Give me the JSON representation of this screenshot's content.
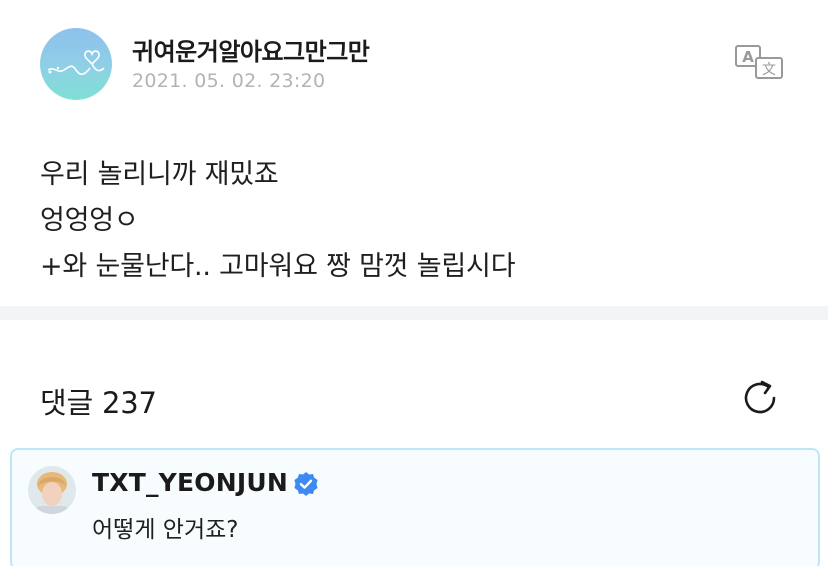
{
  "post": {
    "author": "귀여운거알아요그만그만",
    "date": "2021. 05. 02. 23:20",
    "translate_icon": "translate-icon",
    "lines": [
      "우리 놀리니까 재밌죠",
      "엉엉엉ㅇ",
      "+와 눈물난다.. 고마워요 짱 맘껏 놀립시다"
    ]
  },
  "comments": {
    "label": "댓글 237",
    "refresh_icon": "refresh-icon",
    "items": [
      {
        "author": "TXT_YEONJUN",
        "verified_icon": "verified-badge-icon",
        "text": "어떻게 안거죠?"
      }
    ]
  },
  "colors": {
    "accent_border": "#bfe6f4",
    "verified_blue": "#3d8bf2",
    "date_gray": "#b3b3b3"
  }
}
